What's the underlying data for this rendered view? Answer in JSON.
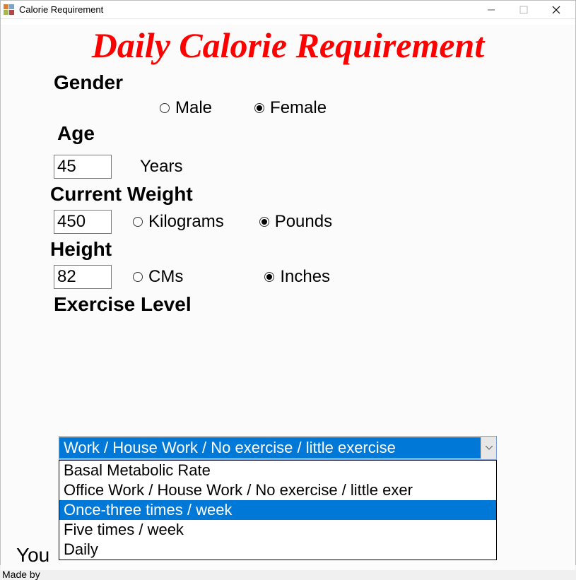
{
  "window": {
    "title": "Calorie Requirement"
  },
  "heading": "Daily Calorie Requirement",
  "gender": {
    "label": "Gender",
    "options": {
      "male": "Male",
      "female": "Female"
    },
    "selected": "female"
  },
  "age": {
    "label": "Age",
    "value": "45",
    "unit": "Years"
  },
  "weight": {
    "label": "Current Weight",
    "value": "450",
    "units": {
      "kg": "Kilograms",
      "lb": "Pounds"
    },
    "selected_unit": "lb"
  },
  "height": {
    "label": "Height",
    "value": "82",
    "units": {
      "cm": "CMs",
      "in": "Inches"
    },
    "selected_unit": "in"
  },
  "exercise": {
    "label": "Exercise Level",
    "selected_display": "Work / House Work / No exercise / little exercise",
    "highlight_index": 2,
    "options": [
      "Basal Metabolic Rate",
      "Office Work / House Work / No exercise / little exer",
      "Once-three times / week",
      "Five times / week",
      "Daily"
    ]
  },
  "footer": {
    "you_text": "You",
    "made_by": "Made by"
  }
}
